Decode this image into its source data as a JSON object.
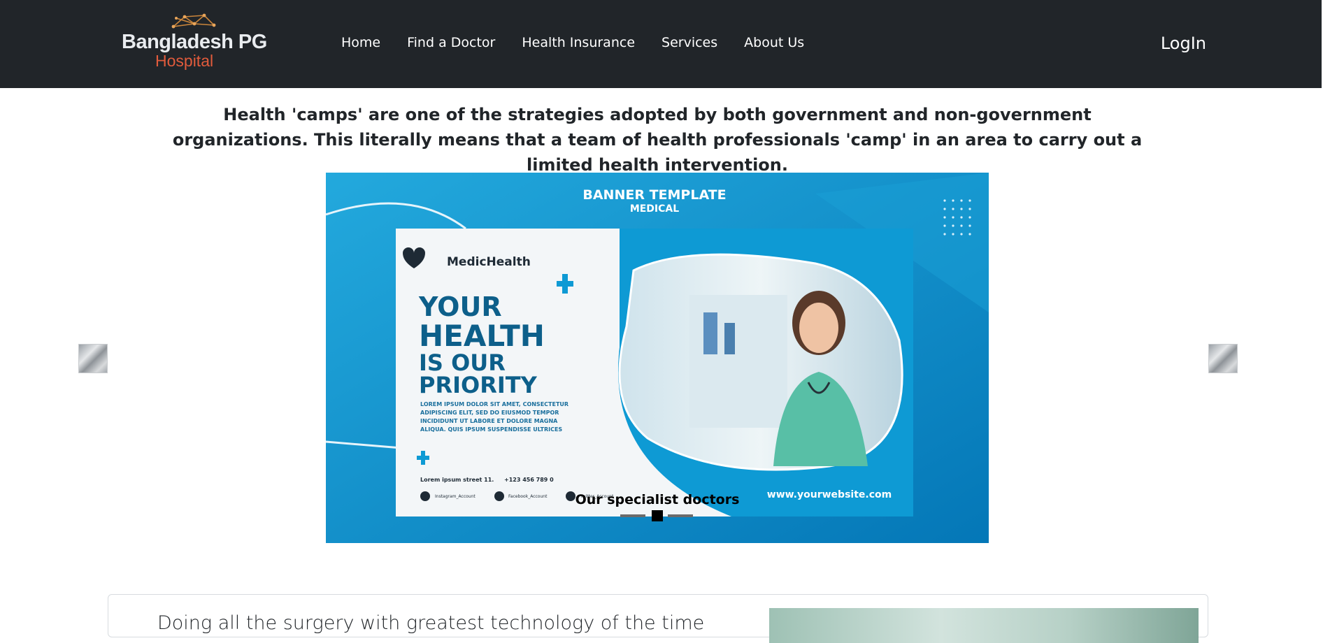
{
  "navbar": {
    "brand_line1": "Bangladesh PG",
    "brand_line2": "Hospital",
    "links": [
      "Home",
      "Find a Doctor",
      "Health Insurance",
      "Services",
      "About Us"
    ],
    "login": "LogIn"
  },
  "intro_text": "Health 'camps' are one of the strategies adopted by both government and non-government organizations. This literally means that a team of health professionals 'camp' in an area to carry out a limited health intervention.",
  "carousel": {
    "caption": "Our specialist doctors",
    "slide_count": 3,
    "active_slide": 2,
    "banner": {
      "header": "BANNER TEMPLATE",
      "subheader": "MEDICAL",
      "brand": "MedicHealth",
      "headline": [
        "YOUR",
        "HEALTH",
        "IS OUR",
        "PRIORITY"
      ],
      "lorem": [
        "LOREM IPSUM DOLOR SIT AMET, CONSECTETUR",
        "ADIPISCING ELIT, SED DO EIUSMOD TEMPOR",
        "INCIDIDUNT UT LABORE ET DOLORE MAGNA",
        "ALIQUA. QUIS IPSUM SUSPENDISSE ULTRICES"
      ],
      "address": "Lorem ipsum street 11.",
      "phone": "+123 456 789 0",
      "social": [
        "Instagram_Account",
        "Facebook_Account",
        "Twitter_Account"
      ],
      "website": "www.yourwebsite.com"
    }
  },
  "card": {
    "text": "Doing all the surgery with greatest technology of the time"
  },
  "colors": {
    "navbar_bg": "#212529",
    "brand_accent": "#e15b3c",
    "banner_blue": "#0a8cc9",
    "banner_heading": "#0d5f8a"
  }
}
